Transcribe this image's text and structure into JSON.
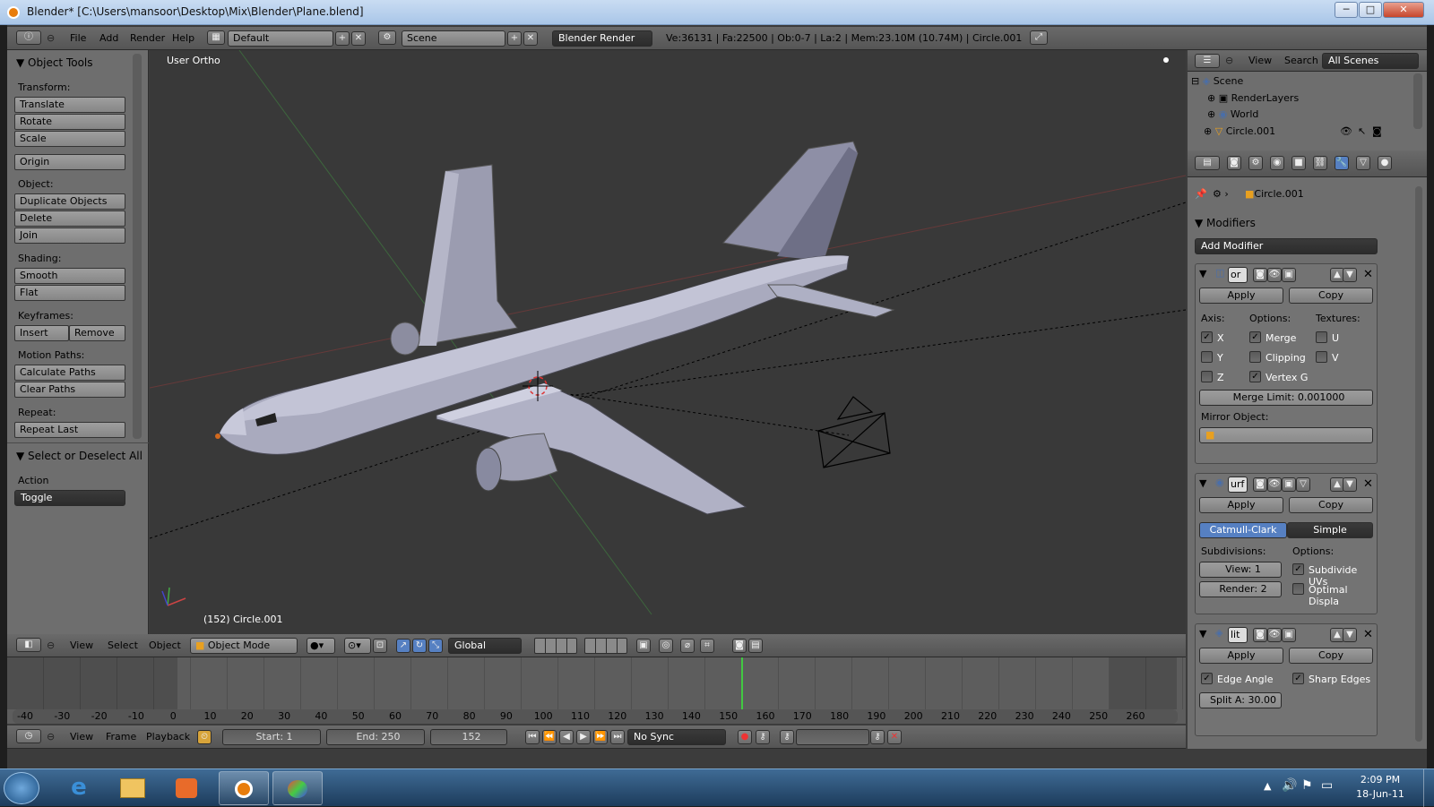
{
  "window": {
    "title": "Blender* [C:\\Users\\mansoor\\Desktop\\Mix\\Blender\\Plane.blend]",
    "min": "─",
    "max": "□",
    "close": "✕"
  },
  "info_header": {
    "menus": [
      "File",
      "Add",
      "Render",
      "Help"
    ],
    "layout": "Default",
    "scene": "Scene",
    "engine": "Blender Render",
    "stats": "Ve:36131 | Fa:22500 | Ob:0-7 | La:2 | Mem:23.10M (10.74M) | Circle.001"
  },
  "tool_shelf": {
    "title": "Object Tools",
    "transform_label": "Transform:",
    "translate": "Translate",
    "rotate": "Rotate",
    "scale": "Scale",
    "origin": "Origin",
    "object_label": "Object:",
    "duplicate": "Duplicate Objects",
    "delete": "Delete",
    "join": "Join",
    "shading_label": "Shading:",
    "smooth": "Smooth",
    "flat": "Flat",
    "keyframes_label": "Keyframes:",
    "insert": "Insert",
    "remove": "Remove",
    "motion_label": "Motion Paths:",
    "calc_paths": "Calculate Paths",
    "clear_paths": "Clear Paths",
    "repeat_label": "Repeat:",
    "repeat_last": "Repeat Last",
    "select_title": "Select or Deselect All",
    "action_label": "Action",
    "action_value": "Toggle"
  },
  "viewport": {
    "view_name": "User Ortho",
    "object_info": "(152) Circle.001"
  },
  "view3d_header": {
    "menus": [
      "View",
      "Select",
      "Object"
    ],
    "mode": "Object Mode",
    "orientation": "Global"
  },
  "timeline": {
    "ruler": [
      "-40",
      "-30",
      "-20",
      "-10",
      "0",
      "10",
      "20",
      "30",
      "40",
      "50",
      "60",
      "70",
      "80",
      "90",
      "100",
      "110",
      "120",
      "130",
      "140",
      "150",
      "160",
      "170",
      "180",
      "190",
      "200",
      "210",
      "220",
      "230",
      "240",
      "250",
      "260"
    ],
    "menus": [
      "View",
      "Frame",
      "Playback"
    ],
    "start": "Start: 1",
    "end": "End: 250",
    "current": "152",
    "sync": "No Sync"
  },
  "outliner": {
    "menus": [
      "View",
      "Search"
    ],
    "filter": "All Scenes",
    "items": [
      "Scene",
      "RenderLayers",
      "World",
      "Circle.001"
    ]
  },
  "properties": {
    "object": "Circle.001",
    "panel_title": "Modifiers",
    "add_modifier": "Add Modifier",
    "apply": "Apply",
    "copy": "Copy",
    "mirror": {
      "name": "or",
      "axis_label": "Axis:",
      "options_label": "Options:",
      "textures_label": "Textures:",
      "x": "X",
      "y": "Y",
      "z": "Z",
      "merge": "Merge",
      "clipping": "Clipping",
      "vertex_g": "Vertex G",
      "u": "U",
      "v": "V",
      "merge_limit": "Merge Limit: 0.001000",
      "mirror_object_label": "Mirror Object:"
    },
    "subsurf": {
      "name": "urf",
      "catmull": "Catmull-Clark",
      "simple": "Simple",
      "subdivisions_label": "Subdivisions:",
      "options_label": "Options:",
      "view": "View: 1",
      "render": "Render: 2",
      "subdivide_uvs": "Subdivide UVs",
      "optimal": "Optimal Displa"
    },
    "edgesplit": {
      "name": "lit",
      "edge_angle": "Edge Angle",
      "sharp_edges": "Sharp Edges",
      "split": "Split A: 30.00"
    }
  },
  "taskbar": {
    "time": "2:09 PM",
    "date": "18-Jun-11"
  },
  "colors": {
    "accent_blue": "#5680c2",
    "viewport_bg": "#393939",
    "panel_bg": "#6e6e6e",
    "frame_line": "#42c842"
  }
}
